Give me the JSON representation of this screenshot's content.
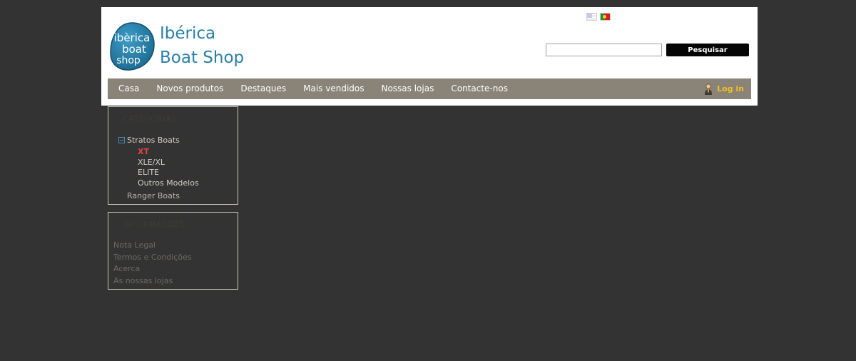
{
  "header": {
    "logo_badge_lines": [
      "ibèrica",
      "boat",
      "shop"
    ],
    "logo_line1": "Ibérica",
    "logo_line2": "Boat Shop",
    "languages": [
      {
        "code": "en",
        "icon": "flag-en-icon"
      },
      {
        "code": "pt",
        "icon": "flag-pt-icon"
      }
    ],
    "search": {
      "value": "",
      "placeholder": "",
      "button_label": "Pesquisar"
    },
    "colors": {
      "logo_blue": "#2a7fa6",
      "nav_bg": "#8a8378",
      "login_yellow": "#f1c21b",
      "page_bg": "#333333"
    }
  },
  "nav": {
    "items": [
      {
        "label": "Casa"
      },
      {
        "label": "Novos produtos"
      },
      {
        "label": "Destaques"
      },
      {
        "label": "Mais vendidos"
      },
      {
        "label": "Nossas lojas"
      },
      {
        "label": "Contacte-nos"
      }
    ],
    "login_label": "Log in",
    "login_icon": "user-icon"
  },
  "categories": {
    "title": "CATEGORIAS",
    "items": [
      {
        "label": "Stratos Boats",
        "expanded": true
      },
      {
        "label": "XT",
        "active": true
      },
      {
        "label": "XLE/XL"
      },
      {
        "label": "ELITE"
      },
      {
        "label": "Outros Modelos"
      },
      {
        "label": "Ranger Boats"
      }
    ]
  },
  "info": {
    "title": "INFORMAÇÕES",
    "links": [
      {
        "label": "Nota Legal"
      },
      {
        "label": "Termos e Condições"
      },
      {
        "label": "Acerca"
      },
      {
        "label": "As nossas lojas"
      }
    ]
  }
}
